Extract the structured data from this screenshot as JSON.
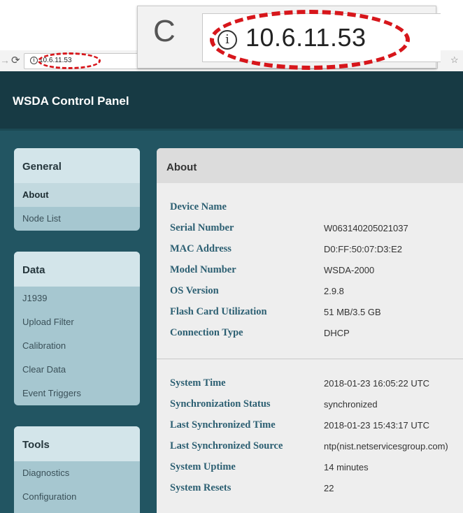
{
  "browser": {
    "url": "10.6.11.53",
    "zoom_url": "10.6.11.53"
  },
  "app": {
    "title": "WSDA Control Panel"
  },
  "sidebar": {
    "panels": [
      {
        "title": "General",
        "items": [
          "About",
          "Node List"
        ]
      },
      {
        "title": "Data",
        "items": [
          "J1939",
          "Upload Filter",
          "Calibration",
          "Clear Data",
          "Event Triggers"
        ]
      },
      {
        "title": "Tools",
        "items": [
          "Diagnostics",
          "Configuration"
        ]
      }
    ],
    "active_item": "About"
  },
  "about": {
    "title": "About",
    "device": [
      {
        "label": "Device Name",
        "value": ""
      },
      {
        "label": "Serial Number",
        "value": "W063140205021037"
      },
      {
        "label": "MAC Address",
        "value": "D0:FF:50:07:D3:E2"
      },
      {
        "label": "Model Number",
        "value": "WSDA-2000"
      },
      {
        "label": "OS Version",
        "value": "2.9.8"
      },
      {
        "label": "Flash Card Utilization",
        "value": "51 MB/3.5 GB"
      },
      {
        "label": "Connection Type",
        "value": "DHCP"
      }
    ],
    "system": [
      {
        "label": "System Time",
        "value": "2018-01-23 16:05:22 UTC"
      },
      {
        "label": "Synchronization Status",
        "value": "synchronized"
      },
      {
        "label": "Last Synchronized Time",
        "value": "2018-01-23 15:43:17 UTC"
      },
      {
        "label": "Last Synchronized Source",
        "value": "ntp(nist.netservicesgroup.com)"
      },
      {
        "label": "System Uptime",
        "value": "14 minutes"
      },
      {
        "label": "System Resets",
        "value": "22"
      }
    ]
  },
  "colors": {
    "header": "#173a44",
    "body": "#225562",
    "highlight_ellipse": "#d7161b",
    "label_text": "#2c5f72"
  },
  "icons": [
    "back-arrow-icon",
    "reload-icon",
    "info-icon",
    "bookmark-star-icon"
  ]
}
